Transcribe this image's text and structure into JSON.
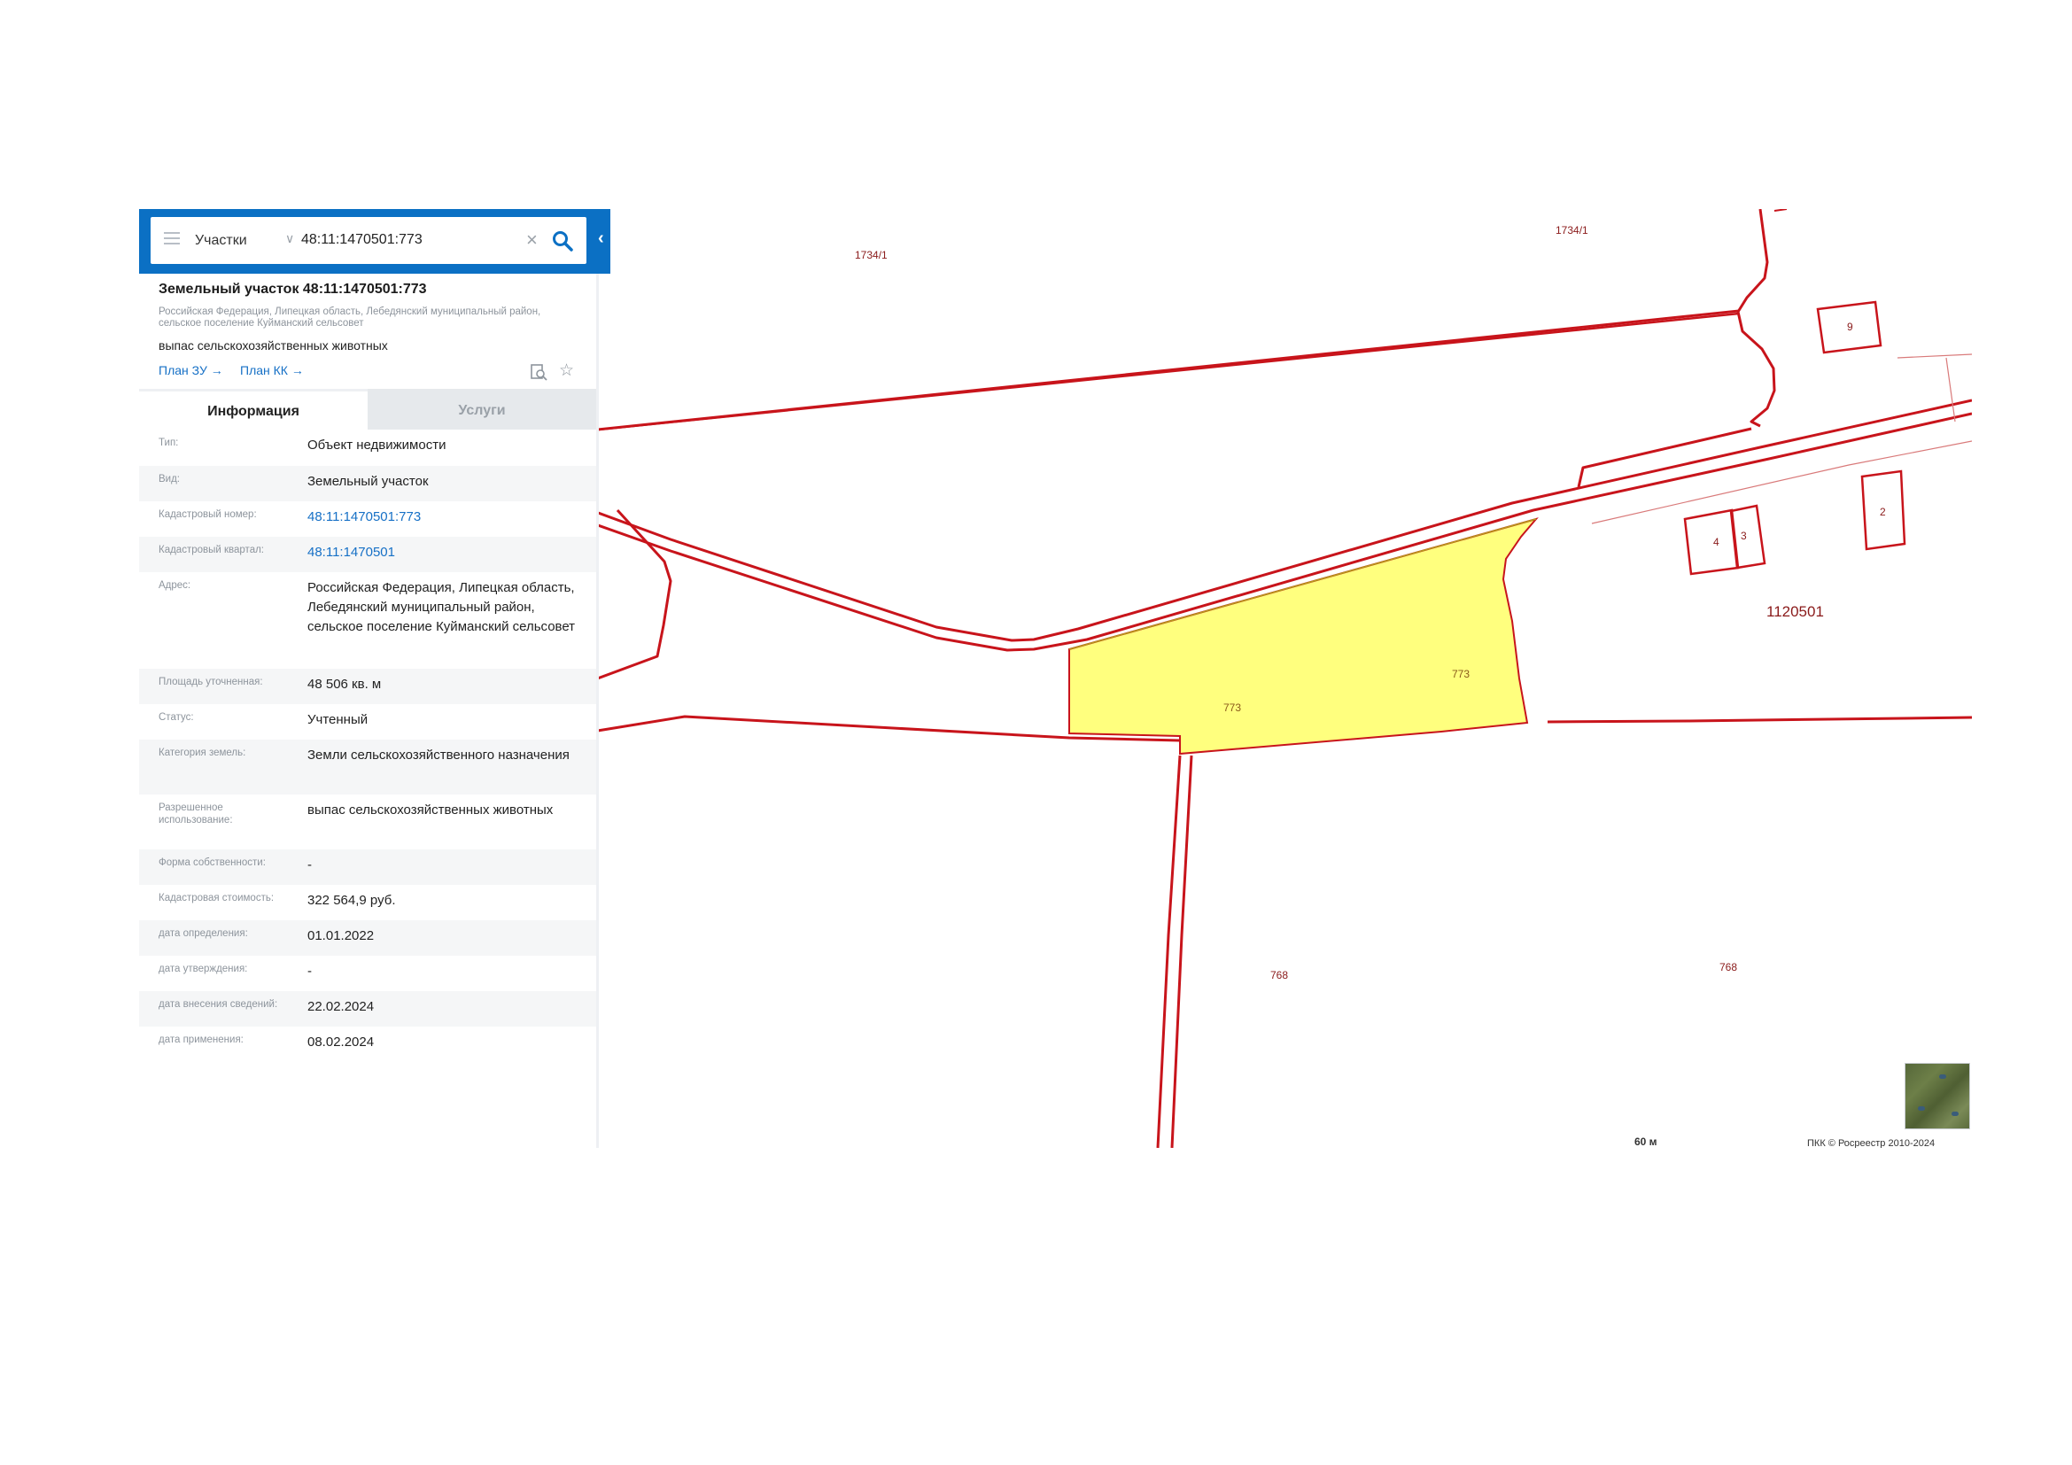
{
  "search": {
    "layer": "Участки",
    "query": "48:11:1470501:773"
  },
  "object": {
    "title": "Земельный участок 48:11:1470501:773",
    "address": "Российская Федерация, Липецкая область, Лебедянский муниципальный район, сельское поселение Куйманский сельсовет",
    "use": "выпас сельскохозяйственных животных",
    "links": {
      "plan_zu": "План ЗУ →",
      "plan_kk": "План КК →"
    }
  },
  "tabs": {
    "info": "Информация",
    "services": "Услуги",
    "active": "info"
  },
  "info_rows": [
    {
      "label": "Тип:",
      "value": "Объект недвижимости",
      "link": false
    },
    {
      "label": "Вид:",
      "value": "Земельный участок",
      "link": false
    },
    {
      "label": "Кадастровый номер:",
      "value": "48:11:1470501:773",
      "link": true
    },
    {
      "label": "Кадастровый квартал:",
      "value": "48:11:1470501",
      "link": true
    },
    {
      "label": "Адрес:",
      "value": "Российская Федерация, Липецкая область, Лебедянский муниципальный район, сельское поселение Куйманский сельсовет",
      "link": false
    },
    {
      "label": "Площадь уточненная:",
      "value": "48 506 кв. м",
      "link": false
    },
    {
      "label": "Статус:",
      "value": "Учтенный",
      "link": false
    },
    {
      "label": "Категория земель:",
      "value": "Земли сельскохозяйственного назначения",
      "link": false
    },
    {
      "label": "Разрешенное использование:",
      "value": "выпас сельскохозяйственных животных",
      "link": false
    },
    {
      "label": "Форма собственности:",
      "value": "-",
      "link": false
    },
    {
      "label": "Кадастровая стоимость:",
      "value": "322 564,9 руб.",
      "link": false
    },
    {
      "label": "дата определения:",
      "value": "01.01.2022",
      "link": false
    },
    {
      "label": "дата утверждения:",
      "value": "-",
      "link": false
    },
    {
      "label": "дата внесения сведений:",
      "value": "22.02.2024",
      "link": false
    },
    {
      "label": "дата применения:",
      "value": "08.02.2024",
      "link": false
    }
  ],
  "map": {
    "labels": {
      "parcel_1734_left": "1734/1",
      "parcel_1734_top": "1734/1",
      "building_9": "9",
      "building_2": "2",
      "building_3": "3",
      "building_4": "4",
      "quarter": "1120501",
      "selected_a": "773",
      "selected_b": "773",
      "parcel_768_left": "768",
      "parcel_768_right": "768"
    },
    "scale": "60 м",
    "copyright": "ПКК © Росреестр 2010-2024",
    "colors": {
      "boundary": "#c8141b",
      "selected_fill": "#ffff7e",
      "panel_header": "#0b70c4",
      "link": "#1670c6"
    }
  }
}
